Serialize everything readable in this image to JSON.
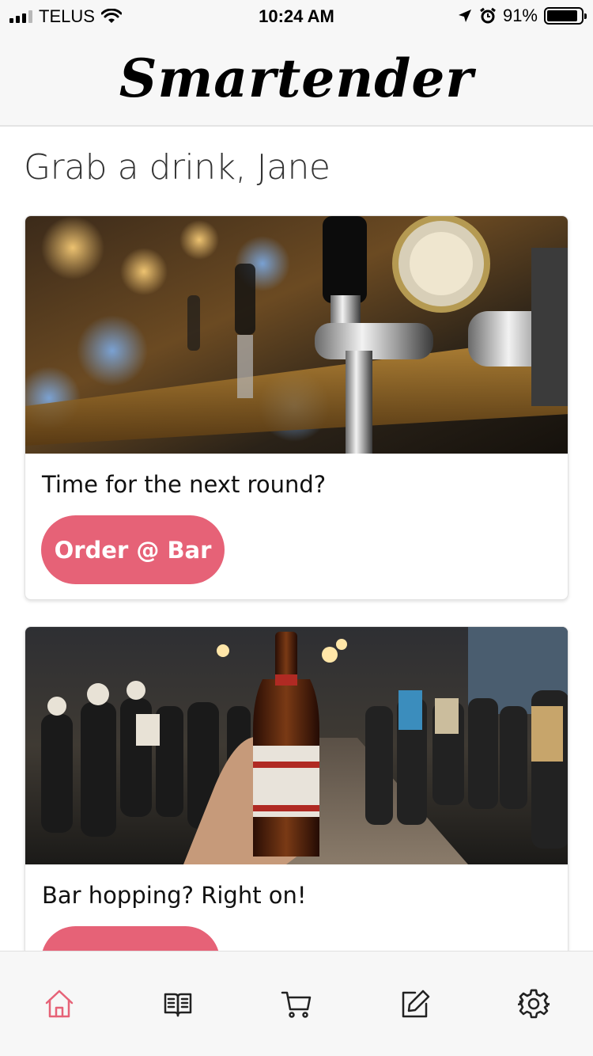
{
  "status_bar": {
    "carrier": "TELUS",
    "time": "10:24 AM",
    "battery_percent": "91%",
    "battery_level": 0.91
  },
  "header": {
    "title": "Smartender"
  },
  "greeting": "Grab a drink, Jane",
  "cards": [
    {
      "text": "Time for the next round?",
      "button_label": "Order @ Bar",
      "image": "beer-taps-photo"
    },
    {
      "text": "Bar hopping? Right on!",
      "button_label": "",
      "image": "street-beer-bottle-photo"
    }
  ],
  "tab_bar": {
    "active": "home",
    "tabs": [
      {
        "id": "home",
        "icon": "home-icon"
      },
      {
        "id": "menu",
        "icon": "book-icon"
      },
      {
        "id": "cart",
        "icon": "cart-icon"
      },
      {
        "id": "edit",
        "icon": "edit-icon"
      },
      {
        "id": "settings",
        "icon": "gear-icon"
      }
    ]
  },
  "colors": {
    "accent": "#e66277",
    "active_tab": "#e66277",
    "inactive_tab": "#222222"
  }
}
